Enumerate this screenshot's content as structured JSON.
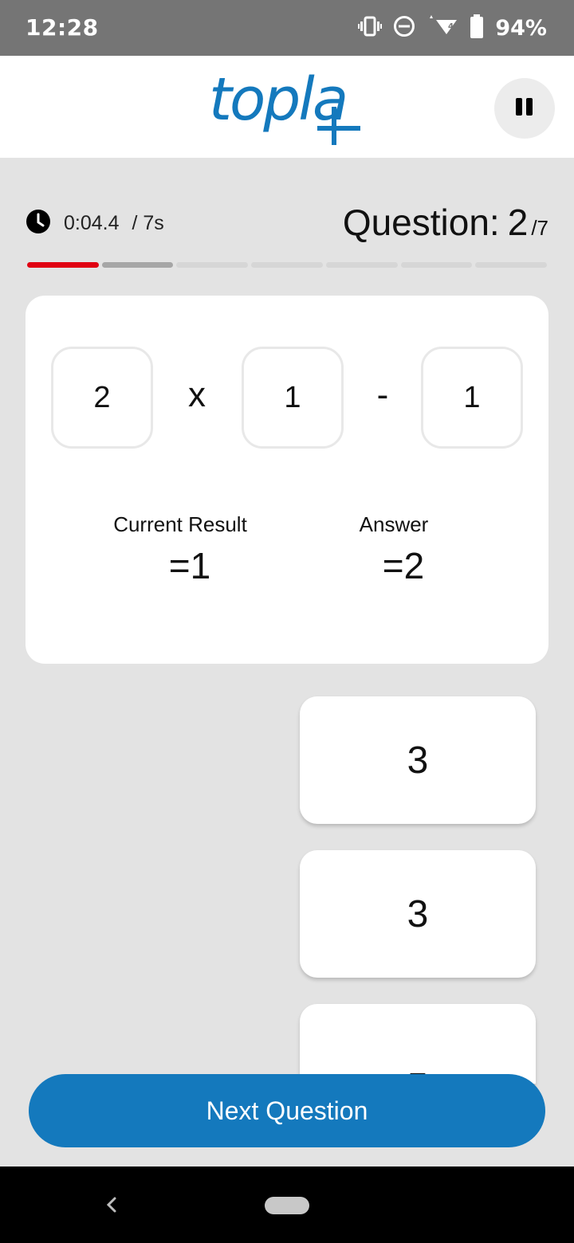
{
  "status_bar": {
    "time": "12:28",
    "battery": "94%",
    "icons": [
      "vibrate-icon",
      "do-not-disturb-icon",
      "wifi-icon",
      "battery-icon"
    ]
  },
  "header": {
    "logo_text": "topla",
    "logo_color": "#1479bd",
    "pause_icon": "pause-icon"
  },
  "timer": {
    "elapsed": "0:04.4",
    "limit": "/ 7s",
    "icon": "clock-icon"
  },
  "question": {
    "label": "Question:",
    "number": "2",
    "total": "/7"
  },
  "progress": {
    "completed": 1,
    "current": 2,
    "total": 7,
    "colors": {
      "done": "#e00012",
      "current": "#a6a6a6",
      "pending": "#d6d6d6"
    }
  },
  "equation": {
    "operand1": "2",
    "operator1": "x",
    "operand2": "1",
    "operator2": "-",
    "operand3": "1"
  },
  "result": {
    "current_label": "Current Result",
    "current_value": "=1",
    "answer_label": "Answer",
    "answer_value": "=2"
  },
  "options": [
    "3",
    "3",
    "5"
  ],
  "next_button": {
    "label": "Next Question",
    "color": "#1479bd"
  },
  "nav_bar": {
    "back_icon": "back-icon",
    "home_icon": "home-pill-icon"
  }
}
